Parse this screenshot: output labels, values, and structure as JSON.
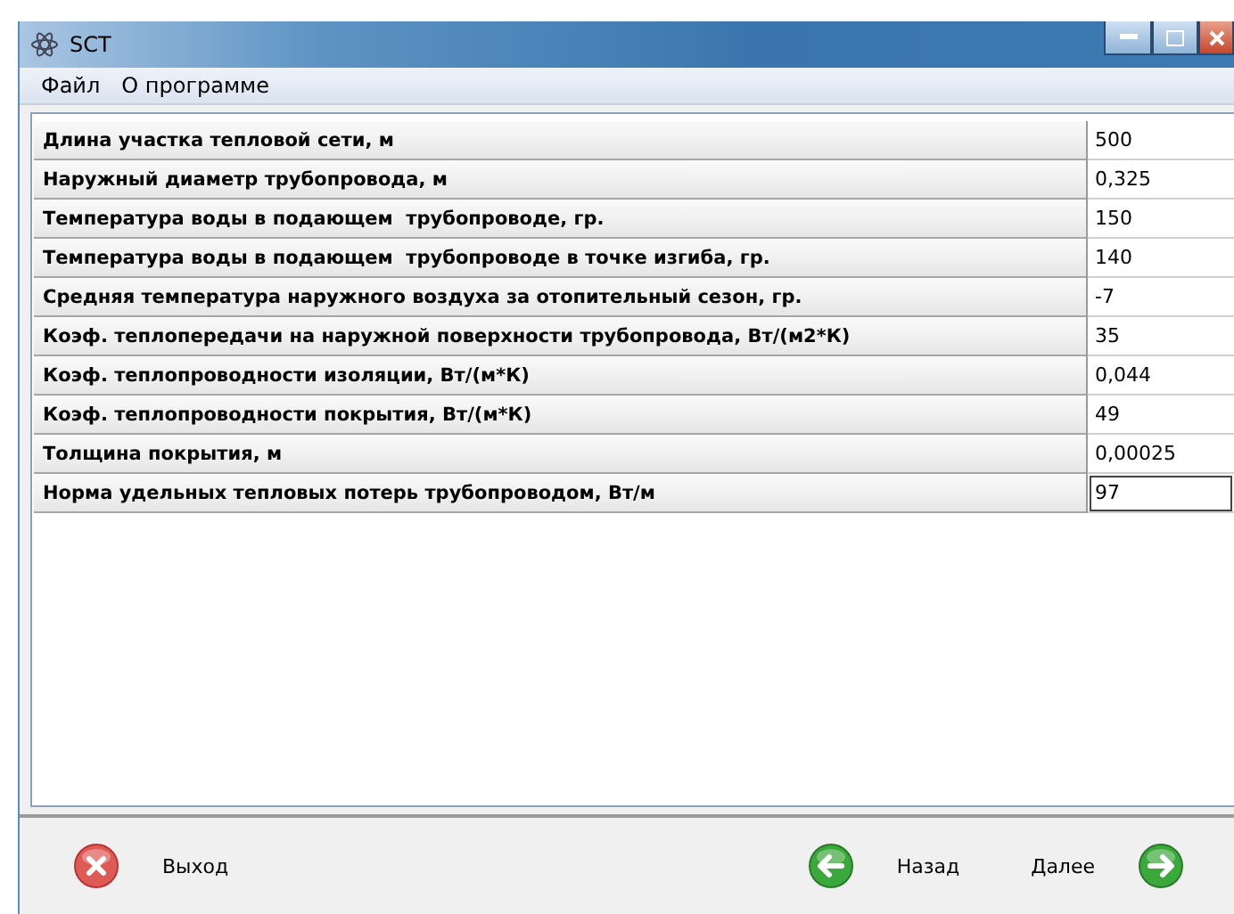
{
  "window": {
    "title": "SCT"
  },
  "menu": [
    "Файл",
    "О программе"
  ],
  "rows": [
    {
      "label": "Длина участка тепловой сети, м",
      "value": "500"
    },
    {
      "label": "Наружный диаметр трубопровода, м",
      "value": "0,325"
    },
    {
      "label": "Температура воды в подающем  трубопроводе, гр.",
      "value": "150"
    },
    {
      "label": "Температура воды в подающем  трубопроводе в точке изгиба, гр.",
      "value": "140"
    },
    {
      "label": "Средняя температура наружного воздуха за отопительный сезон, гр.",
      "value": "-7"
    },
    {
      "label": "Коэф. теплопередачи на наружной поверхности трубопровода, Вт/(м2*К)",
      "value": "35"
    },
    {
      "label": "Коэф. теплопроводности изоляции, Вт/(м*К)",
      "value": "0,044"
    },
    {
      "label": "Коэф. теплопроводности покрытия, Вт/(м*К)",
      "value": "49"
    },
    {
      "label": "Толщина покрытия, м",
      "value": "0,00025"
    },
    {
      "label": "Норма удельных тепловых потерь трубопроводом, Вт/м",
      "value": "97"
    }
  ],
  "buttons": {
    "exit": "Выход",
    "back": "Назад",
    "next": "Далее"
  }
}
